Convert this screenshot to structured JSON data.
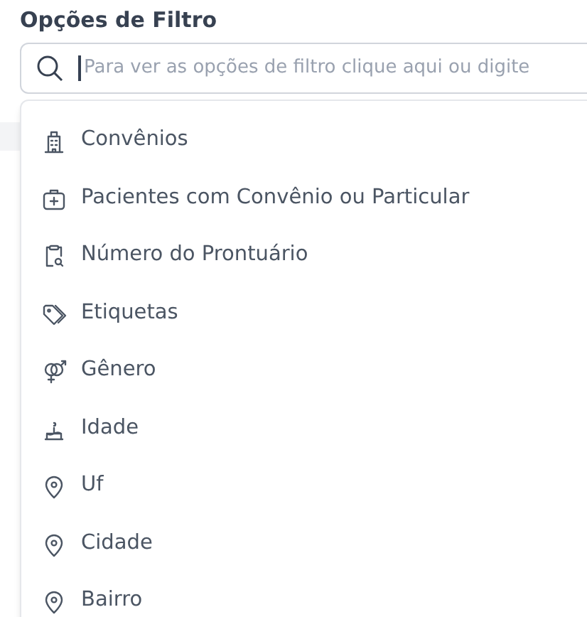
{
  "title": "Opções de Filtro",
  "search": {
    "placeholder": "Para ver as opções de filtro clique aqui ou digite"
  },
  "options": [
    {
      "label": "Convênios"
    },
    {
      "label": "Pacientes com Convênio ou Particular"
    },
    {
      "label": "Número do Prontuário"
    },
    {
      "label": "Etiquetas"
    },
    {
      "label": "Gênero"
    },
    {
      "label": "Idade"
    },
    {
      "label": "Uf"
    },
    {
      "label": "Cidade"
    },
    {
      "label": "Bairro"
    }
  ]
}
